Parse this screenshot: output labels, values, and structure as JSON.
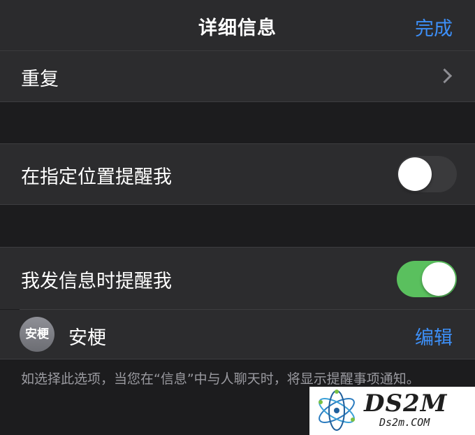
{
  "nav": {
    "title": "详细信息",
    "done_label": "完成"
  },
  "repeat": {
    "label": "重复"
  },
  "location_reminder": {
    "label": "在指定位置提醒我",
    "enabled": false
  },
  "message_reminder": {
    "label": "我发信息时提醒我",
    "enabled": true
  },
  "contact": {
    "avatar_text": "安梗",
    "name": "安梗",
    "edit_label": "编辑"
  },
  "footnote": {
    "text": "如选择此选项，当您在“信息”中与人聊天时，将显示提醒事项通知。"
  },
  "watermark": {
    "brand": "DS2M",
    "domain": "Ds2m.COM"
  },
  "colors": {
    "accent": "#3d8ff7",
    "toggle_on": "#5ac05e",
    "background": "#1c1c1e",
    "cell": "#2c2c2e"
  },
  "icons": {
    "chevron": "chevron-right-icon",
    "watermark_logo": "orbit-logo-icon"
  }
}
